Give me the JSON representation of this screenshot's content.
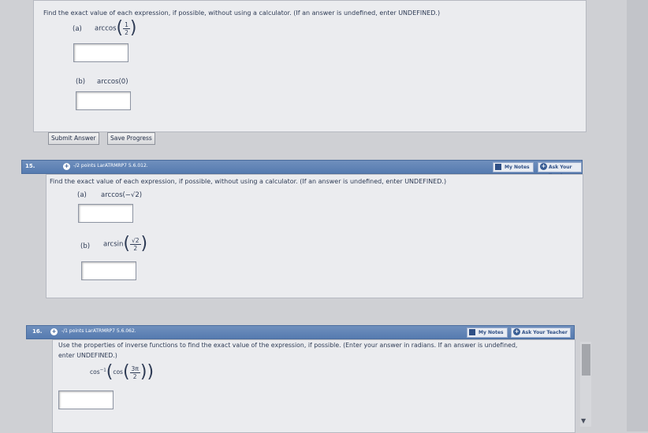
{
  "q14": {
    "instruction": "Find the exact value of each expression, if possible, without using a calculator. (If an answer is undefined, enter UNDEFINED.)",
    "part_a_label": "(a)",
    "part_a_expr_prefix": "arccos",
    "part_a_frac_num": "1",
    "part_a_frac_den": "2",
    "part_b_label": "(b)",
    "part_b_expr": "arccos(0)",
    "submit_label": "Submit Answer",
    "save_label": "Save Progress"
  },
  "q15": {
    "number": "15.",
    "points": "-/2 points  LarATRMRP7 5.6.012.",
    "my_notes": "My Notes",
    "ask_teacher": "Ask Your Teacher",
    "instruction": "Find the exact value of each expression, if possible, without using a calculator. (If an answer is undefined, enter UNDEFINED.)",
    "part_a_label": "(a)",
    "part_a_expr": "arccos(−√2)",
    "part_b_label": "(b)",
    "part_b_expr_prefix": "arcsin",
    "part_b_frac_num": "√2",
    "part_b_frac_den": "2"
  },
  "q16": {
    "number": "16.",
    "points": "-/1 points  LarATRMRP7 5.6.062.",
    "my_notes": "My Notes",
    "ask_teacher": "Ask Your Teacher",
    "instruction_line1": "Use the properties of inverse functions to find the exact value of the expression, if possible. (Enter your answer in radians. If an answer is undefined,",
    "instruction_line2": "enter UNDEFINED.)",
    "expr_prefix": "cos",
    "expr_sup": "−1",
    "expr_inner": "cos",
    "frac_num": "3π",
    "frac_den": "2"
  }
}
